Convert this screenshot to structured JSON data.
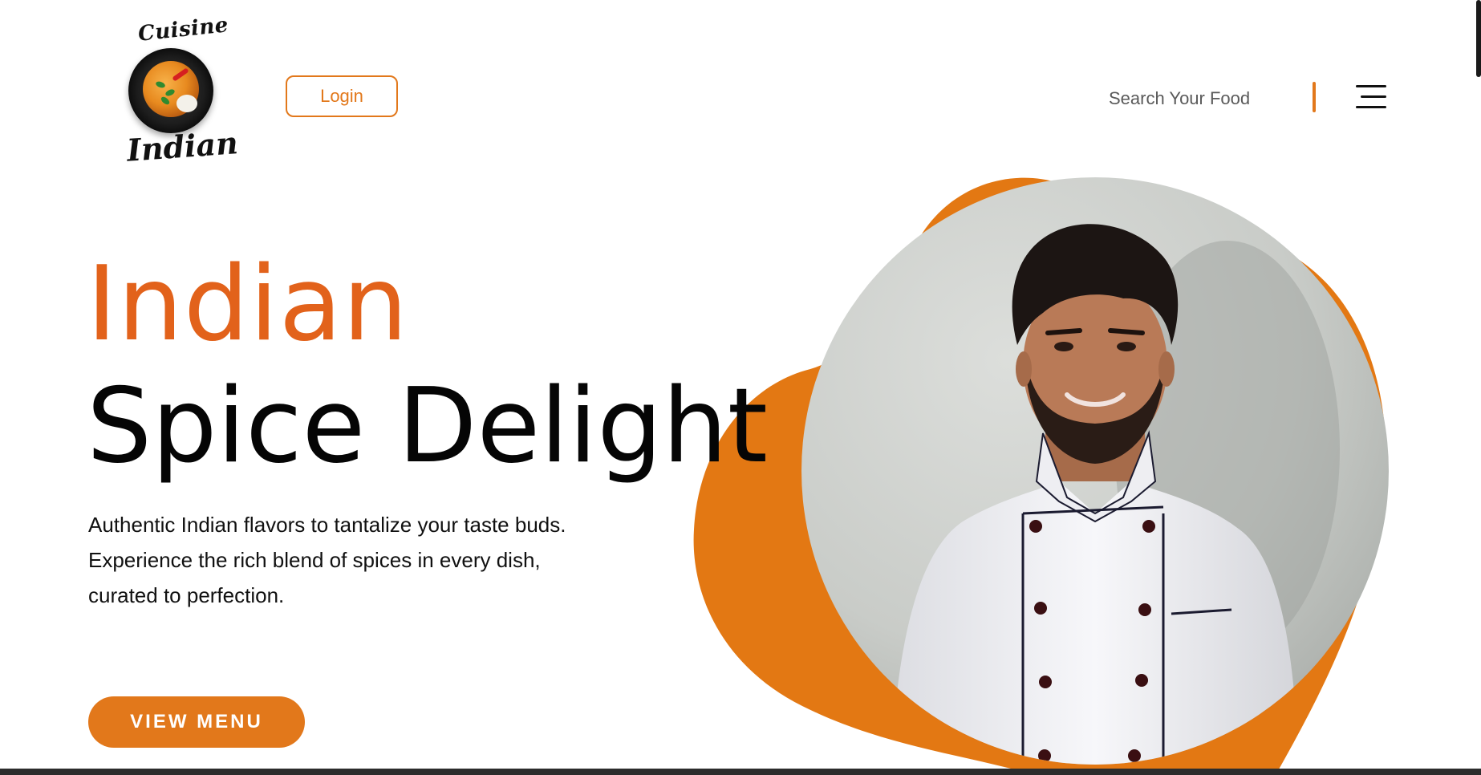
{
  "logo": {
    "top_text": "Cuisine",
    "bottom_text": "Indian",
    "icon": "curry-bowl-icon"
  },
  "header": {
    "login_label": "Login",
    "search_placeholder": "Search Your Food",
    "menu_icon": "hamburger-menu-icon"
  },
  "hero": {
    "title_line1": "Indian",
    "title_line2": "Spice Delight",
    "description": [
      "Authentic Indian flavors to tantalize your taste buds.",
      "Experience the rich blend of spices in every dish,",
      "curated to perfection."
    ],
    "cta_label": "VIEW MENU"
  },
  "colors": {
    "accent": "#e2781b",
    "title_accent": "#e2621b",
    "text": "#111111",
    "background": "#ffffff"
  }
}
